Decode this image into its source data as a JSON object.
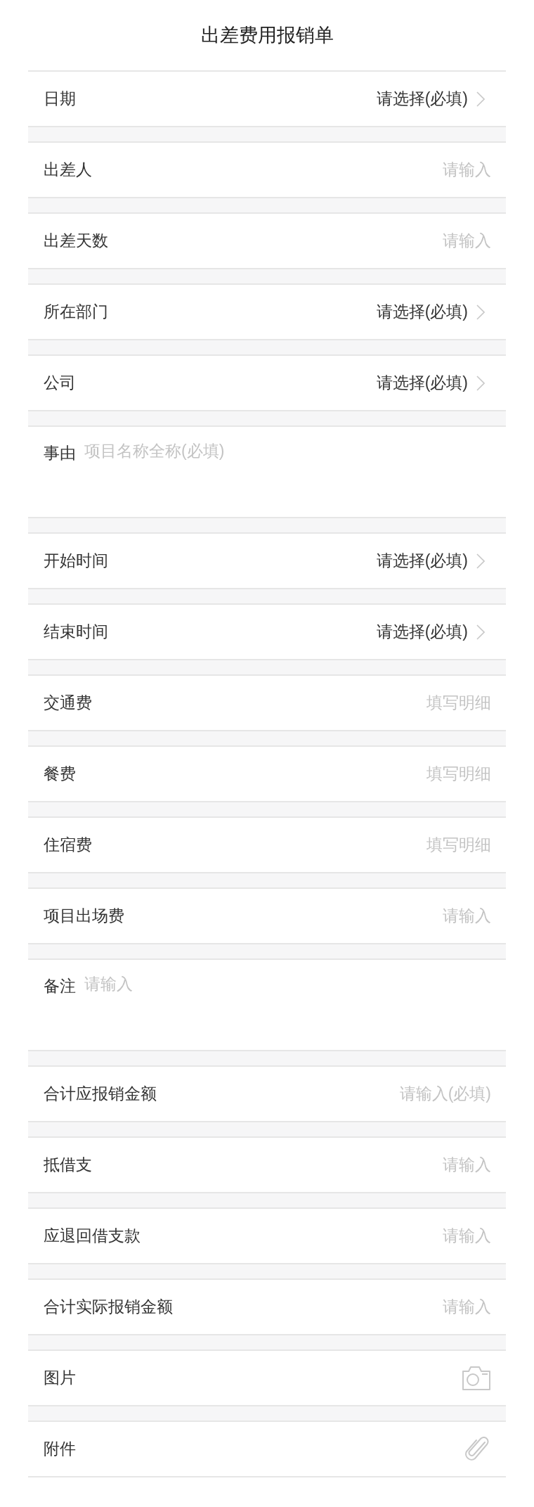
{
  "title": "出差费用报销单",
  "fields": [
    {
      "kind": "select",
      "label": "日期",
      "prompt": "请选择(必填)"
    },
    {
      "kind": "input",
      "label": "出差人",
      "placeholder": "请输入"
    },
    {
      "kind": "input",
      "label": "出差天数",
      "placeholder": "请输入"
    },
    {
      "kind": "select",
      "label": "所在部门",
      "prompt": "请选择(必填)"
    },
    {
      "kind": "select",
      "label": "公司",
      "prompt": "请选择(必填)"
    },
    {
      "kind": "textarea",
      "label": "事由",
      "placeholder": "项目名称全称(必填)"
    },
    {
      "kind": "select",
      "label": "开始时间",
      "prompt": "请选择(必填)"
    },
    {
      "kind": "select",
      "label": "结束时间",
      "prompt": "请选择(必填)"
    },
    {
      "kind": "input",
      "label": "交通费",
      "placeholder": "填写明细"
    },
    {
      "kind": "input",
      "label": "餐费",
      "placeholder": "填写明细"
    },
    {
      "kind": "input",
      "label": "住宿费",
      "placeholder": "填写明细"
    },
    {
      "kind": "input",
      "label": "项目出场费",
      "placeholder": "请输入"
    },
    {
      "kind": "textarea",
      "label": "备注",
      "placeholder": "请输入"
    },
    {
      "kind": "input",
      "label": "合计应报销金额",
      "placeholder": "请输入(必填)"
    },
    {
      "kind": "input",
      "label": "抵借支",
      "placeholder": "请输入"
    },
    {
      "kind": "input",
      "label": "应退回借支款",
      "placeholder": "请输入"
    },
    {
      "kind": "input",
      "label": "合计实际报销金额",
      "placeholder": "请输入"
    },
    {
      "kind": "image",
      "label": "图片"
    },
    {
      "kind": "file",
      "label": "附件"
    }
  ]
}
